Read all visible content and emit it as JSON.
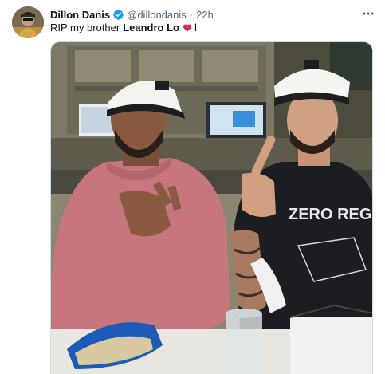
{
  "author": {
    "display_name": "Dillon Danis",
    "handle": "@dillondanis",
    "separator": "·",
    "timestamp": "22h",
    "verified": true
  },
  "tweet": {
    "text_prefix": "RIP my brother",
    "mention": "Leandro Lo",
    "emoji": "red-heart",
    "text_suffix": "l"
  },
  "media": {
    "description_icon": "photo",
    "tshirt_text": "ZERO REGRET"
  },
  "colors": {
    "verified_blue": "#1d9bf0",
    "secondary_text": "#536471",
    "heart_red": "#e0245e"
  }
}
